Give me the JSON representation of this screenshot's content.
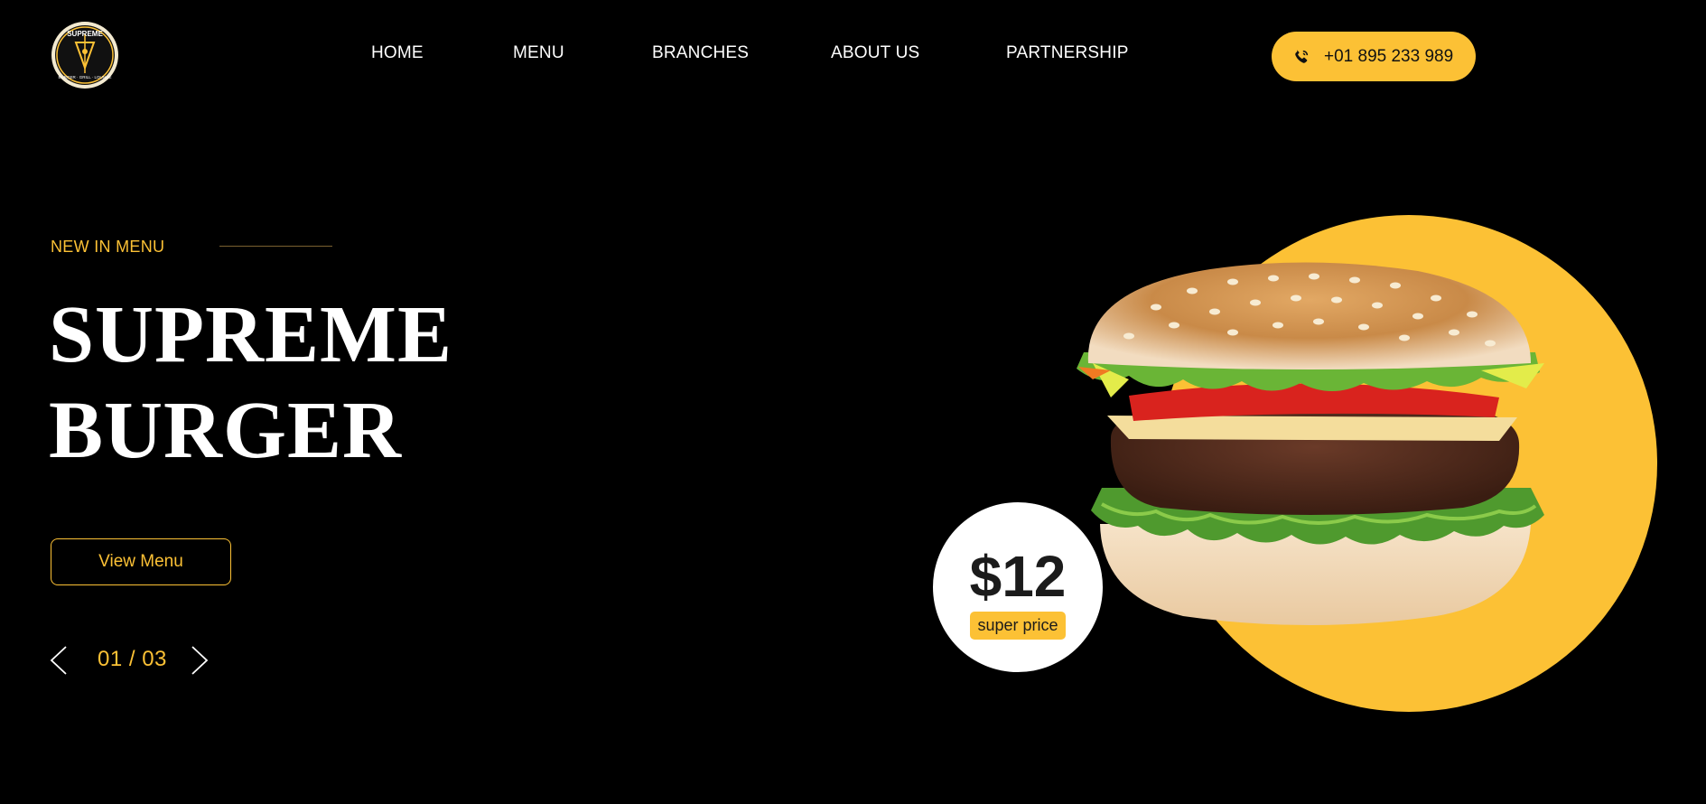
{
  "brand": {
    "logo_text_top": "SUPREME",
    "logo_text_bottom": "BURGER · GRILL · LOUNGE"
  },
  "nav": {
    "items": [
      "HOME",
      "MENU",
      "BRANCHES",
      "ABOUT US",
      "PARTNERSHIP"
    ]
  },
  "header": {
    "phone": "+01 895 233 989",
    "phone_icon": "phone-icon"
  },
  "hero": {
    "eyebrow": "NEW IN MENU",
    "title_line1": "SUPREME",
    "title_line2": "BURGER",
    "cta_label": "View Menu",
    "slide_counter": "01 / 03"
  },
  "price": {
    "value": "$12",
    "tag": "super price"
  },
  "colors": {
    "accent": "#fcc135",
    "background": "#000000",
    "text": "#ffffff"
  }
}
